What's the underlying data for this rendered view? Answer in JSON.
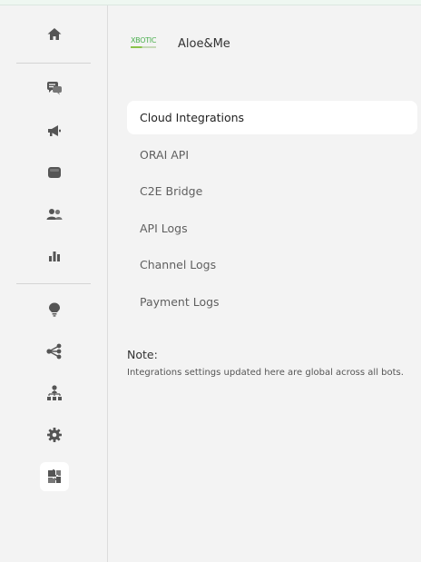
{
  "sidebar": {
    "icons": [
      {
        "name": "home-icon"
      },
      {
        "name": "chat-icon"
      },
      {
        "name": "megaphone-icon"
      },
      {
        "name": "contact-card-icon"
      },
      {
        "name": "users-icon"
      },
      {
        "name": "bar-chart-icon"
      },
      {
        "name": "lightbulb-icon"
      },
      {
        "name": "share-nodes-icon"
      },
      {
        "name": "hierarchy-icon"
      },
      {
        "name": "gear-icon"
      },
      {
        "name": "puzzle-icon"
      }
    ],
    "active": "puzzle-icon"
  },
  "brand": {
    "logo_text": "XBOTIC",
    "name": "Aloe&Me"
  },
  "menu": {
    "items": [
      {
        "label": "Cloud Integrations",
        "active": true
      },
      {
        "label": "ORAI API"
      },
      {
        "label": "C2E Bridge"
      },
      {
        "label": "API Logs"
      },
      {
        "label": "Channel Logs"
      },
      {
        "label": "Payment Logs"
      }
    ]
  },
  "note": {
    "title": "Note:",
    "text": "Integrations settings updated here are global across all bots."
  },
  "colors": {
    "background": "#f3f3f3",
    "active_bg": "#ffffff",
    "icon": "#555555",
    "brand_green": "#4caf50"
  }
}
